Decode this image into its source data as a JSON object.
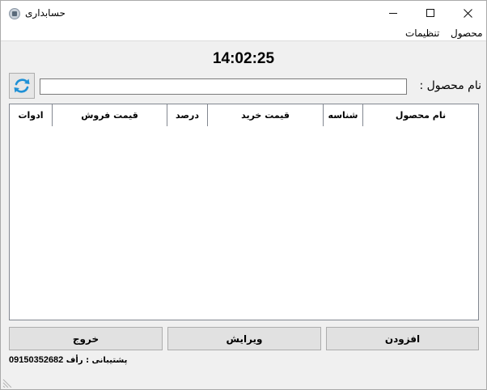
{
  "window": {
    "title": "حسابداری",
    "app_icon": "ledger-icon",
    "controls": {
      "minimize": "minimize-icon",
      "maximize": "maximize-icon",
      "close": "close-icon"
    }
  },
  "menu": {
    "items": [
      {
        "label": "محصول"
      },
      {
        "label": "تنظیمات"
      }
    ]
  },
  "clock": "14:02:25",
  "search": {
    "label": "نام محصول :",
    "value": "",
    "refresh_icon": "refresh-icon"
  },
  "table": {
    "columns": [
      "نام محصول",
      "شناسه",
      "قیمت خرید",
      "درصد",
      "قیمت فروش",
      "ادوات"
    ],
    "rows": []
  },
  "actions": {
    "add": "افزودن",
    "edit": "ویرایش",
    "exit": "خروج"
  },
  "support": {
    "label": "پشتیبانی : رأف",
    "phone": "09150352682"
  },
  "colors": {
    "refresh_icon": "#1e90d6",
    "window_bg": "#f0f0f0"
  }
}
